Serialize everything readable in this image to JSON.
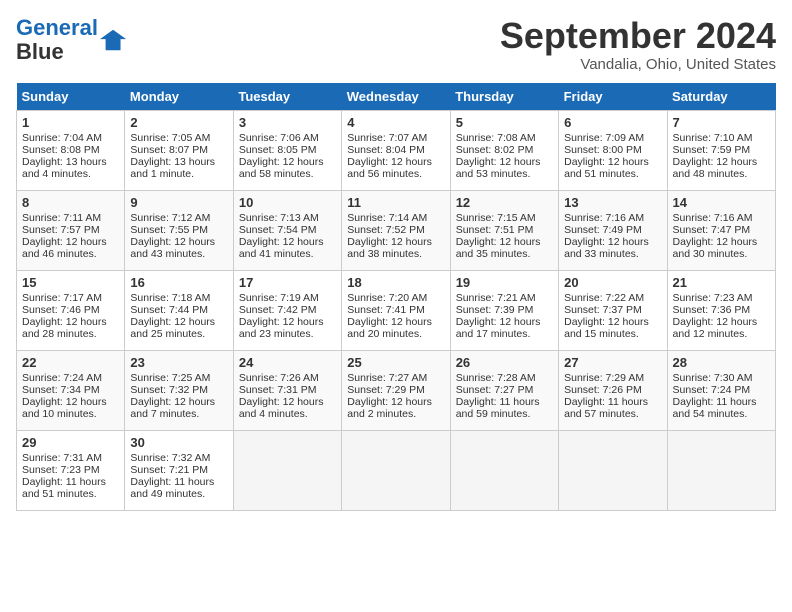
{
  "header": {
    "logo_line1": "General",
    "logo_line2": "Blue",
    "month_title": "September 2024",
    "location": "Vandalia, Ohio, United States"
  },
  "days_of_week": [
    "Sunday",
    "Monday",
    "Tuesday",
    "Wednesday",
    "Thursday",
    "Friday",
    "Saturday"
  ],
  "weeks": [
    [
      {
        "day": 1,
        "sunrise": "7:04 AM",
        "sunset": "8:08 PM",
        "daylight": "13 hours and 4 minutes."
      },
      {
        "day": 2,
        "sunrise": "7:05 AM",
        "sunset": "8:07 PM",
        "daylight": "13 hours and 1 minute."
      },
      {
        "day": 3,
        "sunrise": "7:06 AM",
        "sunset": "8:05 PM",
        "daylight": "12 hours and 58 minutes."
      },
      {
        "day": 4,
        "sunrise": "7:07 AM",
        "sunset": "8:04 PM",
        "daylight": "12 hours and 56 minutes."
      },
      {
        "day": 5,
        "sunrise": "7:08 AM",
        "sunset": "8:02 PM",
        "daylight": "12 hours and 53 minutes."
      },
      {
        "day": 6,
        "sunrise": "7:09 AM",
        "sunset": "8:00 PM",
        "daylight": "12 hours and 51 minutes."
      },
      {
        "day": 7,
        "sunrise": "7:10 AM",
        "sunset": "7:59 PM",
        "daylight": "12 hours and 48 minutes."
      }
    ],
    [
      {
        "day": 8,
        "sunrise": "7:11 AM",
        "sunset": "7:57 PM",
        "daylight": "12 hours and 46 minutes."
      },
      {
        "day": 9,
        "sunrise": "7:12 AM",
        "sunset": "7:55 PM",
        "daylight": "12 hours and 43 minutes."
      },
      {
        "day": 10,
        "sunrise": "7:13 AM",
        "sunset": "7:54 PM",
        "daylight": "12 hours and 41 minutes."
      },
      {
        "day": 11,
        "sunrise": "7:14 AM",
        "sunset": "7:52 PM",
        "daylight": "12 hours and 38 minutes."
      },
      {
        "day": 12,
        "sunrise": "7:15 AM",
        "sunset": "7:51 PM",
        "daylight": "12 hours and 35 minutes."
      },
      {
        "day": 13,
        "sunrise": "7:16 AM",
        "sunset": "7:49 PM",
        "daylight": "12 hours and 33 minutes."
      },
      {
        "day": 14,
        "sunrise": "7:16 AM",
        "sunset": "7:47 PM",
        "daylight": "12 hours and 30 minutes."
      }
    ],
    [
      {
        "day": 15,
        "sunrise": "7:17 AM",
        "sunset": "7:46 PM",
        "daylight": "12 hours and 28 minutes."
      },
      {
        "day": 16,
        "sunrise": "7:18 AM",
        "sunset": "7:44 PM",
        "daylight": "12 hours and 25 minutes."
      },
      {
        "day": 17,
        "sunrise": "7:19 AM",
        "sunset": "7:42 PM",
        "daylight": "12 hours and 23 minutes."
      },
      {
        "day": 18,
        "sunrise": "7:20 AM",
        "sunset": "7:41 PM",
        "daylight": "12 hours and 20 minutes."
      },
      {
        "day": 19,
        "sunrise": "7:21 AM",
        "sunset": "7:39 PM",
        "daylight": "12 hours and 17 minutes."
      },
      {
        "day": 20,
        "sunrise": "7:22 AM",
        "sunset": "7:37 PM",
        "daylight": "12 hours and 15 minutes."
      },
      {
        "day": 21,
        "sunrise": "7:23 AM",
        "sunset": "7:36 PM",
        "daylight": "12 hours and 12 minutes."
      }
    ],
    [
      {
        "day": 22,
        "sunrise": "7:24 AM",
        "sunset": "7:34 PM",
        "daylight": "12 hours and 10 minutes."
      },
      {
        "day": 23,
        "sunrise": "7:25 AM",
        "sunset": "7:32 PM",
        "daylight": "12 hours and 7 minutes."
      },
      {
        "day": 24,
        "sunrise": "7:26 AM",
        "sunset": "7:31 PM",
        "daylight": "12 hours and 4 minutes."
      },
      {
        "day": 25,
        "sunrise": "7:27 AM",
        "sunset": "7:29 PM",
        "daylight": "12 hours and 2 minutes."
      },
      {
        "day": 26,
        "sunrise": "7:28 AM",
        "sunset": "7:27 PM",
        "daylight": "11 hours and 59 minutes."
      },
      {
        "day": 27,
        "sunrise": "7:29 AM",
        "sunset": "7:26 PM",
        "daylight": "11 hours and 57 minutes."
      },
      {
        "day": 28,
        "sunrise": "7:30 AM",
        "sunset": "7:24 PM",
        "daylight": "11 hours and 54 minutes."
      }
    ],
    [
      {
        "day": 29,
        "sunrise": "7:31 AM",
        "sunset": "7:23 PM",
        "daylight": "11 hours and 51 minutes."
      },
      {
        "day": 30,
        "sunrise": "7:32 AM",
        "sunset": "7:21 PM",
        "daylight": "11 hours and 49 minutes."
      },
      null,
      null,
      null,
      null,
      null
    ]
  ]
}
